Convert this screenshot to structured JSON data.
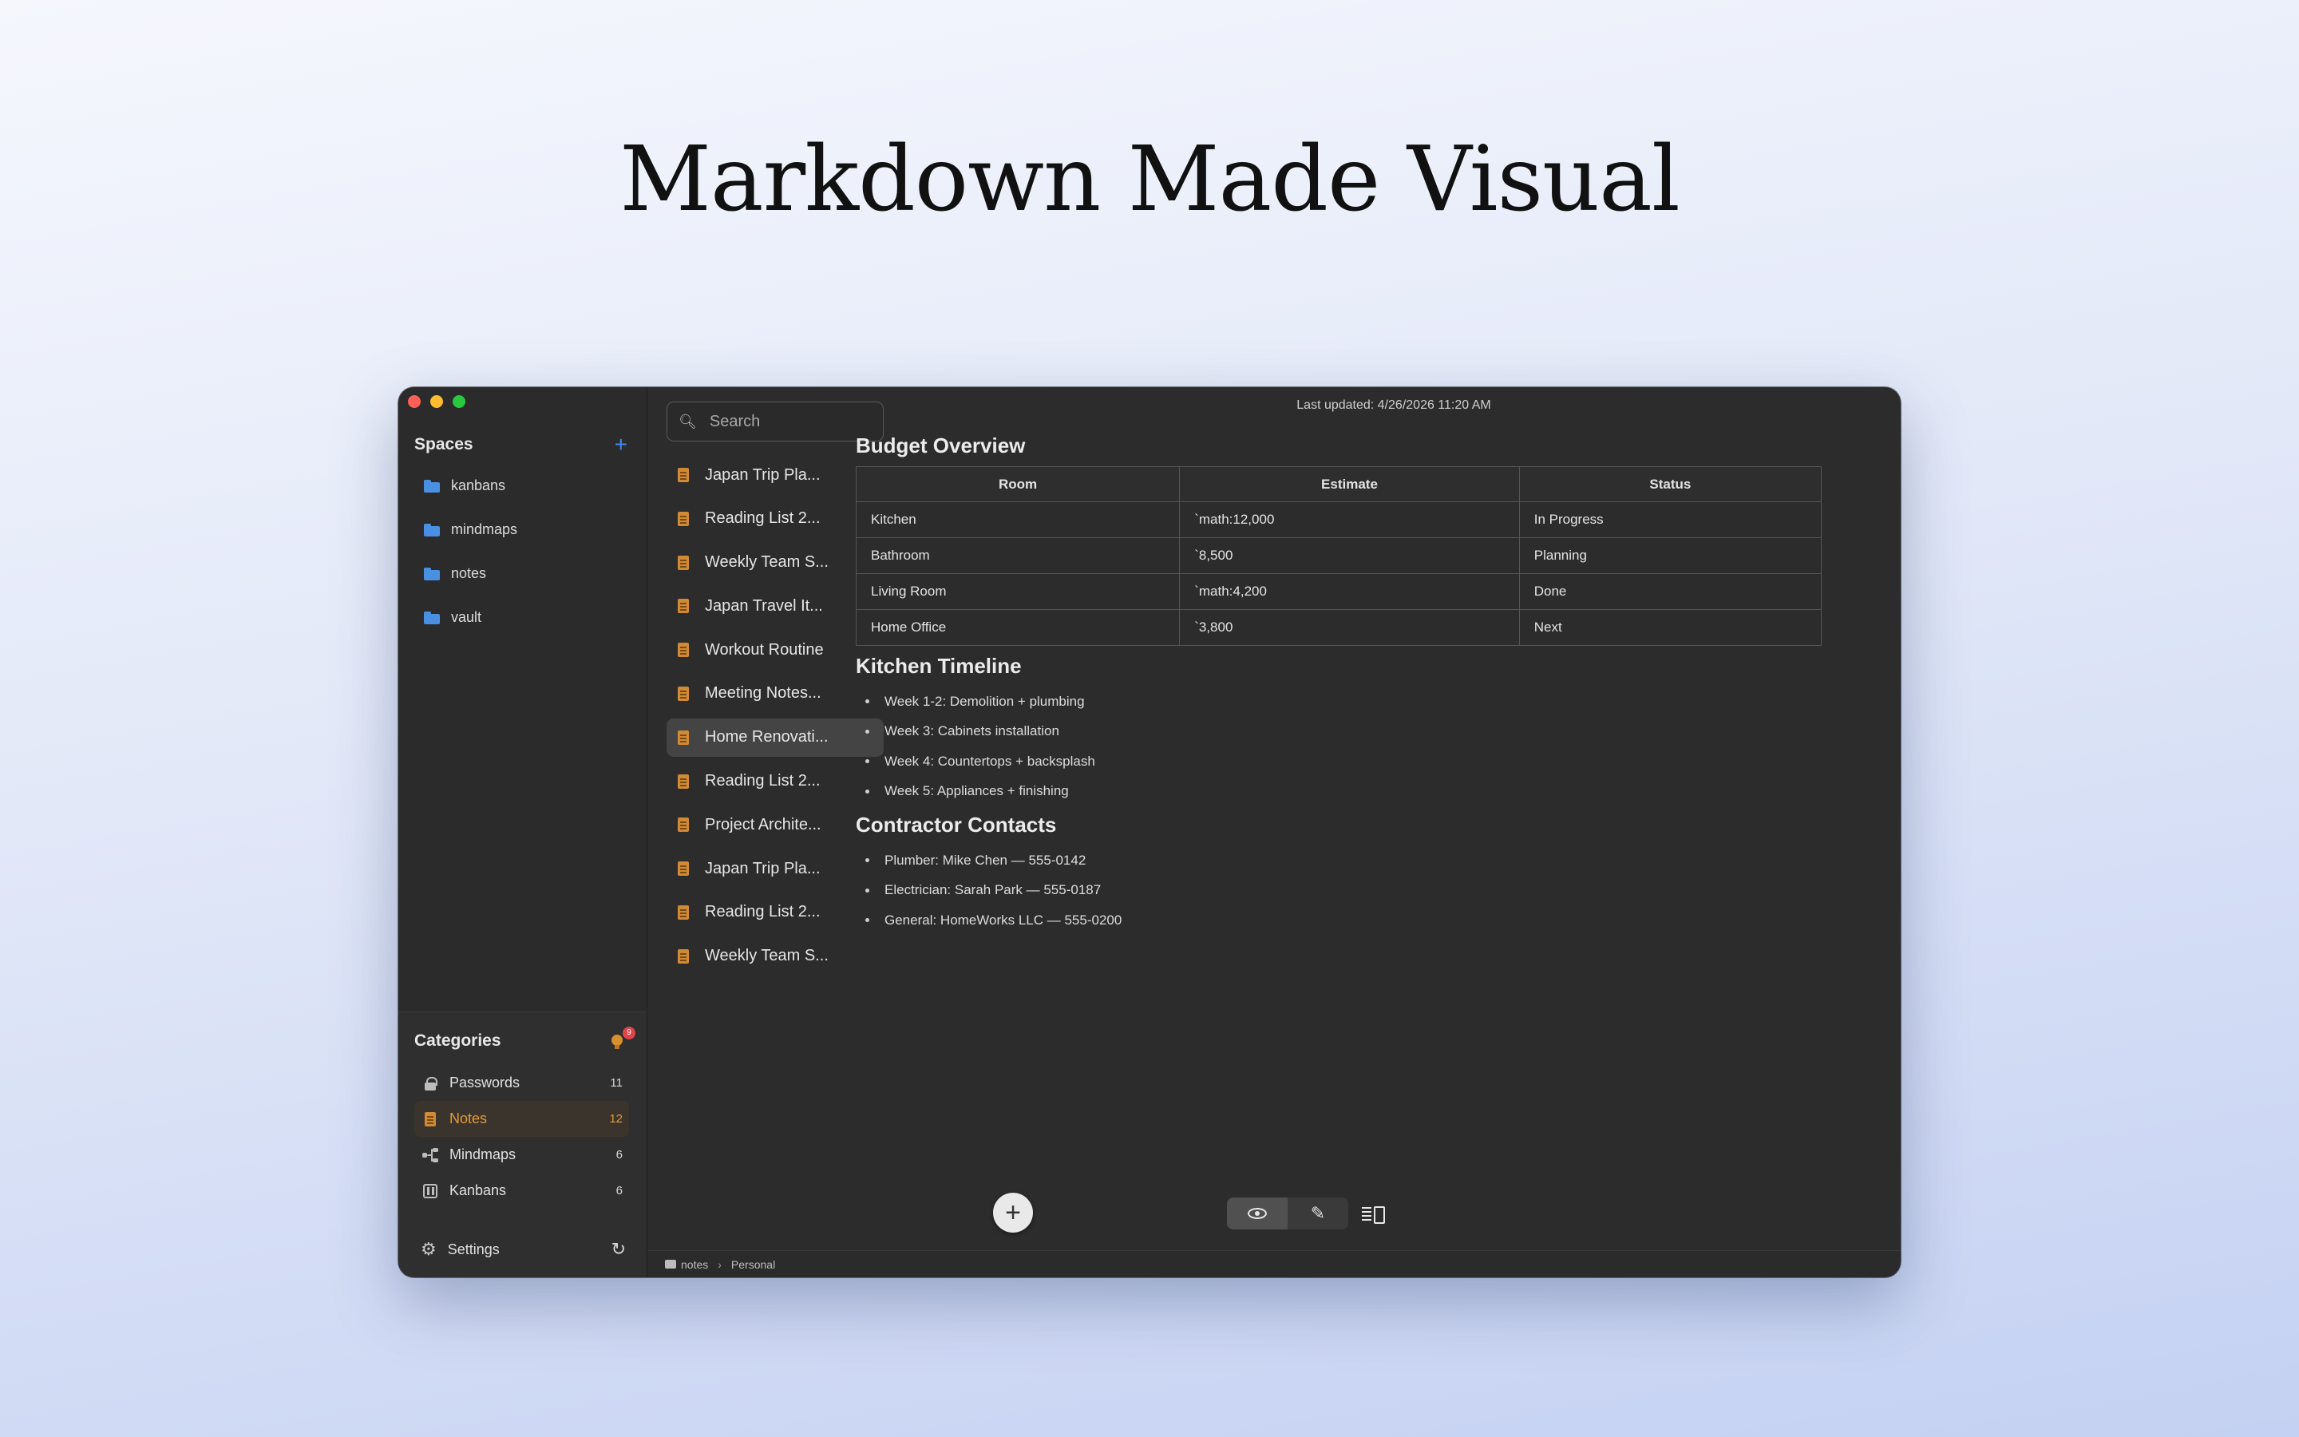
{
  "hero": {
    "title": "Markdown Made Visual"
  },
  "window": {
    "last_updated": "Last updated: 4/26/2026 11:20 AM"
  },
  "sidebar": {
    "spaces_title": "Spaces",
    "add_space_icon": "plus-icon",
    "spaces": [
      {
        "label": "kanbans",
        "icon": "folder-icon"
      },
      {
        "label": "mindmaps",
        "icon": "folder-icon"
      },
      {
        "label": "notes",
        "icon": "folder-icon"
      },
      {
        "label": "vault",
        "icon": "folder-icon"
      }
    ],
    "categories_title": "Categories",
    "tips_badge": "9",
    "categories": [
      {
        "label": "Passwords",
        "count": "11",
        "icon": "lock-icon"
      },
      {
        "label": "Notes",
        "count": "12",
        "icon": "note-icon",
        "active": true
      },
      {
        "label": "Mindmaps",
        "count": "6",
        "icon": "mindmap-icon"
      },
      {
        "label": "Kanbans",
        "count": "6",
        "icon": "kanban-icon"
      }
    ],
    "settings_label": "Settings"
  },
  "notes": {
    "search_placeholder": "Search",
    "items": [
      "Japan Trip Pla...",
      "Reading List 2...",
      "Weekly Team S...",
      "Japan Travel It...",
      "Workout Routine",
      "Meeting Notes...",
      "Home Renovati...",
      "Reading List 2...",
      "Project Archite...",
      "Japan Trip Pla...",
      "Reading List 2...",
      "Weekly Team S..."
    ],
    "selected_index": 6,
    "add_button": "+"
  },
  "document": {
    "budget_heading": "Budget Overview",
    "table": {
      "headers": [
        "Room",
        "Estimate",
        "Status"
      ],
      "rows": [
        [
          "Kitchen",
          "`math:12,000",
          "In Progress"
        ],
        [
          "Bathroom",
          "`8,500",
          "Planning"
        ],
        [
          "Living Room",
          "`math:4,200",
          "Done"
        ],
        [
          "Home Office",
          "`3,800",
          "Next"
        ]
      ]
    },
    "timeline_heading": "Kitchen Timeline",
    "timeline": [
      "Week 1-2: Demolition + plumbing",
      "Week 3: Cabinets installation",
      "Week 4: Countertops + backsplash",
      "Week 5: Appliances + finishing"
    ],
    "contacts_heading": "Contractor Contacts",
    "contacts": [
      "Plumber: Mike Chen — 555-0142",
      "Electrician: Sarah Park — 555-0187",
      "General: HomeWorks LLC — 555-0200"
    ]
  },
  "view_toggle": {
    "modes": [
      "eye-icon",
      "pencil-icon",
      "split-view-icon"
    ],
    "active": "eye-icon"
  },
  "statusbar": {
    "path": [
      "notes",
      "Personal"
    ]
  }
}
